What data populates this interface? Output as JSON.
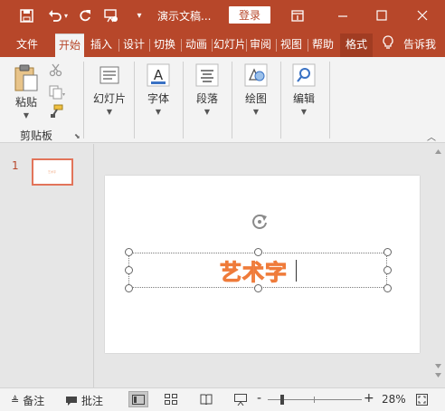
{
  "titlebar": {
    "title": "演示文稿...",
    "login_label": "登录",
    "icons": [
      "save-icon",
      "undo-icon",
      "redo-icon",
      "present-icon",
      "customize-icon",
      "ribbon-display-icon",
      "minimize-icon",
      "restore-icon",
      "close-icon"
    ]
  },
  "tabs": {
    "file": "文件",
    "home": "开始",
    "insert": "插入",
    "design": "设计",
    "transitions": "切换",
    "animations": "动画",
    "slideshow": "幻灯片",
    "review": "审阅",
    "view": "视图",
    "help": "帮助",
    "format": "格式",
    "tell": "告诉我"
  },
  "ribbon": {
    "paste_label": "粘贴",
    "clipboard_group": "剪贴板",
    "slides_label": "幻灯片",
    "font_label": "字体",
    "paragraph_label": "段落",
    "drawing_label": "绘图",
    "editing_label": "编辑"
  },
  "thumbs": {
    "slide_number": "1",
    "thumb_text": "艺术字"
  },
  "slide": {
    "wordart_text": "艺术字"
  },
  "status": {
    "notes_label": "备注",
    "comments_label": "批注",
    "zoom_minus": "-",
    "zoom_plus": "+",
    "zoom_level": "28%",
    "zoom_value": 28
  },
  "colors": {
    "accent": "#b7472a",
    "wordart_fill": "#fbd1b4",
    "wordart_outline": "#ef7b3a"
  }
}
